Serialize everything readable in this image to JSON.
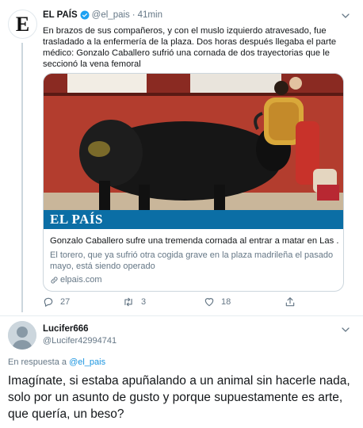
{
  "tweet": {
    "author_name": "EL PAÍS",
    "author_handle": "@el_pais",
    "separator": "·",
    "time": "41min",
    "avatar_letter": "E",
    "text": "En brazos de sus compañeros, y con el muslo izquierdo atravesado, fue trasladado a la enfermería de la plaza. Dos horas después llegaba el parte médico: Gonzalo Caballero sufrió una cornada de dos trayectorias que le seccionó la vena femoral",
    "card": {
      "brand": "EL PAÍS",
      "title": "Gonzalo Caballero sufre una tremenda cornada al entrar a matar en Las ...",
      "description": "El torero, que ya sufrió otra cogida grave en la plaza madrileña el pasado mayo, está siendo operado",
      "link": "elpais.com"
    },
    "actions": {
      "replies": "27",
      "retweets": "3",
      "likes": "18"
    }
  },
  "reply": {
    "author_name": "Lucifer666",
    "author_handle": "@Lucifer42994741",
    "replying_label": "En respuesta a",
    "replying_handle": "@el_pais",
    "text": "Imagínate, si estaba apuñalando a un animal sin hacerle nada, solo por un asunto de gusto y porque supuestamente es arte, que quería, un beso?"
  },
  "colors": {
    "accent": "#1b95e0",
    "secondary_text": "#657786",
    "brand_bar": "#0b6ea5"
  },
  "icons": [
    "verified-icon",
    "chevron-down-icon",
    "reply-icon",
    "retweet-icon",
    "like-icon",
    "share-icon",
    "link-icon"
  ]
}
